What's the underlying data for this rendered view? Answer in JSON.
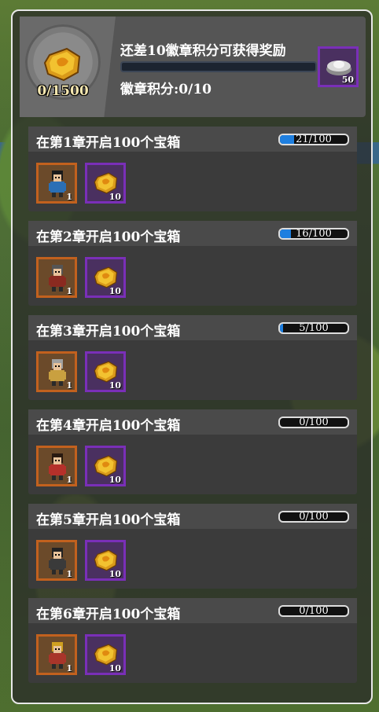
{
  "header": {
    "badge_progress": "0/1500",
    "reward_title": "还差10徽章积分可获得奖励",
    "score_label": "徽章积分:0/10",
    "reward_item": {
      "icon": "silver-ingot-icon",
      "count": "50"
    },
    "reward_progress_fraction": 0
  },
  "tasks": [
    {
      "title": "在第1章开启100个宝箱",
      "progress_text": "21/100",
      "progress": 0.21,
      "hero_icon": "hero-blue-icon",
      "hero_count": "1",
      "badge_count": "10"
    },
    {
      "title": "在第2章开启100个宝箱",
      "progress_text": "16/100",
      "progress": 0.16,
      "hero_icon": "hero-red-icon",
      "hero_count": "1",
      "badge_count": "10"
    },
    {
      "title": "在第3章开启100个宝箱",
      "progress_text": "5/100",
      "progress": 0.05,
      "hero_icon": "hero-gold-icon",
      "hero_count": "1",
      "badge_count": "10"
    },
    {
      "title": "在第4章开启100个宝箱",
      "progress_text": "0/100",
      "progress": 0,
      "hero_icon": "hero-red-hair-icon",
      "hero_count": "1",
      "badge_count": "10"
    },
    {
      "title": "在第5章开启100个宝箱",
      "progress_text": "0/100",
      "progress": 0,
      "hero_icon": "hero-dark-icon",
      "hero_count": "1",
      "badge_count": "10"
    },
    {
      "title": "在第6章开启100个宝箱",
      "progress_text": "0/100",
      "progress": 0,
      "hero_icon": "hero-spear-icon",
      "hero_count": "1",
      "badge_count": "10"
    }
  ],
  "colors": {
    "progress_fill": "#1e7fe0",
    "hero_frame": "#c2611e",
    "badge_frame": "#7a2fb8"
  }
}
